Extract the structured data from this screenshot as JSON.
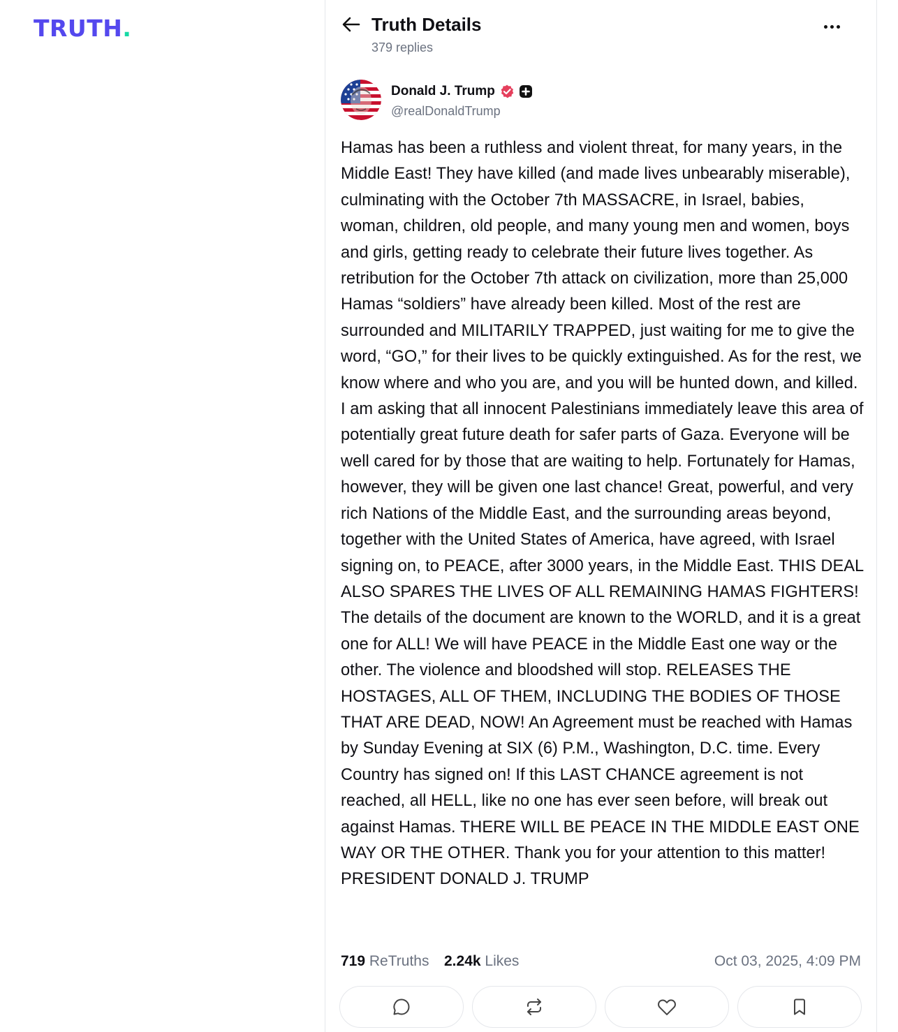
{
  "app": {
    "logo_text": "TRUTH",
    "logo_dot": ".",
    "accent_color": "#5448ee",
    "dot_color": "#17d9a5"
  },
  "header": {
    "back_icon": "arrow-left-icon",
    "title": "Truth Details",
    "replies": "379 replies",
    "more_icon": "more-horizontal-icon"
  },
  "post": {
    "author_name": "Donald J. Trump",
    "verified_icon": "verified-badge-icon",
    "plus_icon": "truth-plus-icon",
    "handle": "@realDonaldTrump",
    "text": "Hamas has been a ruthless and violent threat, for many years, in the Middle East! They have killed (and made lives unbearably miserable), culminating with the October 7th MASSACRE, in Israel, babies, woman, children, old people, and many young men and women, boys and girls, getting ready to celebrate their future lives together. As retribution for the October 7th attack on civilization, more than 25,000 Hamas “soldiers” have already been killed. Most of the rest are surrounded and MILITARILY TRAPPED, just waiting for me to give the word, “GO,” for their lives to be quickly extinguished. As for the rest, we know where and who you are, and you will be hunted down, and killed. I am asking that all innocent Palestinians immediately leave this area of potentially great future death for safer parts of Gaza. Everyone will be well cared for by those that are waiting to help. Fortunately for Hamas, however, they will be given one last chance! Great, powerful, and very rich Nations of the Middle East, and the surrounding areas beyond, together with the United States of America, have agreed, with Israel signing on, to PEACE, after 3000 years, in the Middle East. THIS DEAL ALSO SPARES THE LIVES OF ALL REMAINING HAMAS FIGHTERS! The details of the document are known to the WORLD, and it is a great one for ALL! We will have PEACE in the Middle East one way or the other. The violence and bloodshed will stop. RELEASES THE HOSTAGES, ALL OF THEM, INCLUDING THE BODIES OF THOSE THAT ARE DEAD, NOW! An Agreement must be reached with Hamas by Sunday Evening at SIX (6) P.M., Washington, D.C. time. Every Country has signed on! If this LAST CHANCE agreement is not reached, all HELL, like no one has ever seen before, will break out against Hamas. THERE WILL BE PEACE IN THE MIDDLE EAST ONE WAY OR THE OTHER. Thank you for your attention to this matter! PRESIDENT DONALD J. TRUMP",
    "retruths_count": "719",
    "retruths_label": "ReTruths",
    "likes_count": "2.24k",
    "likes_label": "Likes",
    "timestamp": "Oct 03, 2025, 4:09 PM"
  },
  "actions": [
    {
      "icon": "reply-icon"
    },
    {
      "icon": "retruth-icon"
    },
    {
      "icon": "like-heart-icon"
    },
    {
      "icon": "bookmark-icon"
    }
  ]
}
